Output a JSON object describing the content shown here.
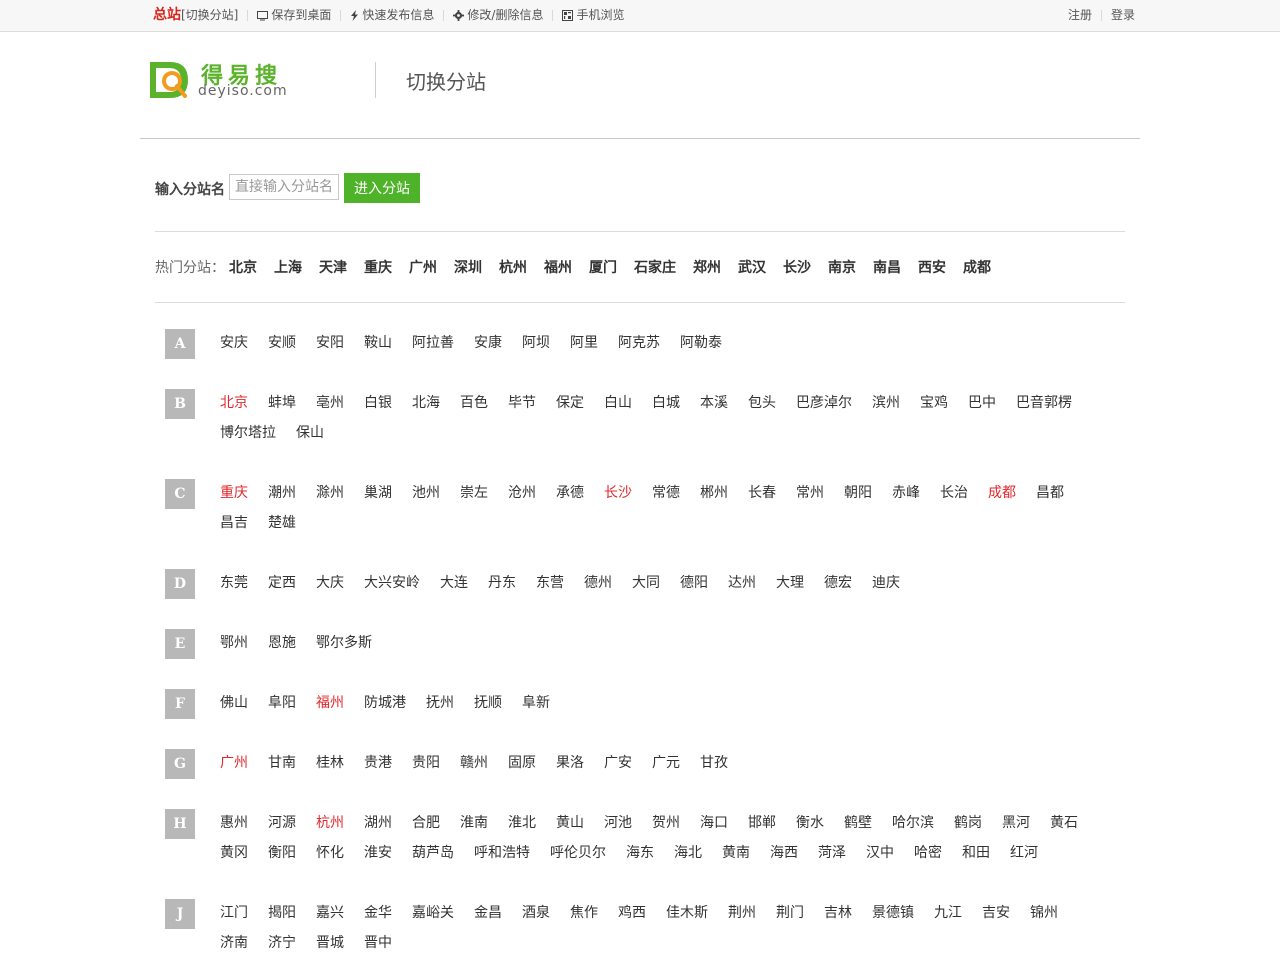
{
  "topbar": {
    "main_site": "总站",
    "switch_link": "[切换分站]",
    "save_desktop": "保存到桌面",
    "quick_post": "快速发布信息",
    "edit_delete": "修改/删除信息",
    "mobile": "手机浏览",
    "register": "注册",
    "login": "登录"
  },
  "header": {
    "logo_cn": "得易搜",
    "logo_en": "deyiso.com",
    "title": "切换分站"
  },
  "search": {
    "label": "输入分站名",
    "placeholder": "直接输入分站名",
    "button": "进入分站"
  },
  "hot": {
    "label": "热门分站：",
    "cities": [
      "北京",
      "上海",
      "天津",
      "重庆",
      "广州",
      "深圳",
      "杭州",
      "福州",
      "厦门",
      "石家庄",
      "郑州",
      "武汉",
      "长沙",
      "南京",
      "南昌",
      "西安",
      "成都"
    ]
  },
  "colors": {
    "accent_green": "#4fb32a",
    "hot_red": "#e0282e",
    "badge_gray": "#b8b8b8"
  },
  "groups": [
    {
      "letter": "A",
      "cities": [
        {
          "name": "安庆"
        },
        {
          "name": "安顺"
        },
        {
          "name": "安阳"
        },
        {
          "name": "鞍山"
        },
        {
          "name": "阿拉善"
        },
        {
          "name": "安康"
        },
        {
          "name": "阿坝"
        },
        {
          "name": "阿里"
        },
        {
          "name": "阿克苏"
        },
        {
          "name": "阿勒泰"
        }
      ]
    },
    {
      "letter": "B",
      "cities": [
        {
          "name": "北京",
          "hot": true
        },
        {
          "name": "蚌埠"
        },
        {
          "name": "亳州"
        },
        {
          "name": "白银"
        },
        {
          "name": "北海"
        },
        {
          "name": "百色"
        },
        {
          "name": "毕节"
        },
        {
          "name": "保定"
        },
        {
          "name": "白山"
        },
        {
          "name": "白城"
        },
        {
          "name": "本溪"
        },
        {
          "name": "包头"
        },
        {
          "name": "巴彦淖尔"
        },
        {
          "name": "滨州"
        },
        {
          "name": "宝鸡"
        },
        {
          "name": "巴中"
        },
        {
          "name": "巴音郭楞"
        },
        {
          "name": "博尔塔拉"
        },
        {
          "name": "保山"
        }
      ]
    },
    {
      "letter": "C",
      "cities": [
        {
          "name": "重庆",
          "hot": true
        },
        {
          "name": "潮州"
        },
        {
          "name": "滁州"
        },
        {
          "name": "巢湖"
        },
        {
          "name": "池州"
        },
        {
          "name": "崇左"
        },
        {
          "name": "沧州"
        },
        {
          "name": "承德"
        },
        {
          "name": "长沙",
          "hot": true
        },
        {
          "name": "常德"
        },
        {
          "name": "郴州"
        },
        {
          "name": "长春"
        },
        {
          "name": "常州"
        },
        {
          "name": "朝阳"
        },
        {
          "name": "赤峰"
        },
        {
          "name": "长治"
        },
        {
          "name": "成都",
          "hot": true
        },
        {
          "name": "昌都"
        },
        {
          "name": "昌吉"
        },
        {
          "name": "楚雄"
        }
      ]
    },
    {
      "letter": "D",
      "cities": [
        {
          "name": "东莞"
        },
        {
          "name": "定西"
        },
        {
          "name": "大庆"
        },
        {
          "name": "大兴安岭"
        },
        {
          "name": "大连"
        },
        {
          "name": "丹东"
        },
        {
          "name": "东营"
        },
        {
          "name": "德州"
        },
        {
          "name": "大同"
        },
        {
          "name": "德阳"
        },
        {
          "name": "达州"
        },
        {
          "name": "大理"
        },
        {
          "name": "德宏"
        },
        {
          "name": "迪庆"
        }
      ]
    },
    {
      "letter": "E",
      "cities": [
        {
          "name": "鄂州"
        },
        {
          "name": "恩施"
        },
        {
          "name": "鄂尔多斯"
        }
      ]
    },
    {
      "letter": "F",
      "cities": [
        {
          "name": "佛山"
        },
        {
          "name": "阜阳"
        },
        {
          "name": "福州",
          "hot": true
        },
        {
          "name": "防城港"
        },
        {
          "name": "抚州"
        },
        {
          "name": "抚顺"
        },
        {
          "name": "阜新"
        }
      ]
    },
    {
      "letter": "G",
      "cities": [
        {
          "name": "广州",
          "hot": true
        },
        {
          "name": "甘南"
        },
        {
          "name": "桂林"
        },
        {
          "name": "贵港"
        },
        {
          "name": "贵阳"
        },
        {
          "name": "赣州"
        },
        {
          "name": "固原"
        },
        {
          "name": "果洛"
        },
        {
          "name": "广安"
        },
        {
          "name": "广元"
        },
        {
          "name": "甘孜"
        }
      ]
    },
    {
      "letter": "H",
      "cities": [
        {
          "name": "惠州"
        },
        {
          "name": "河源"
        },
        {
          "name": "杭州",
          "hot": true
        },
        {
          "name": "湖州"
        },
        {
          "name": "合肥"
        },
        {
          "name": "淮南"
        },
        {
          "name": "淮北"
        },
        {
          "name": "黄山"
        },
        {
          "name": "河池"
        },
        {
          "name": "贺州"
        },
        {
          "name": "海口"
        },
        {
          "name": "邯郸"
        },
        {
          "name": "衡水"
        },
        {
          "name": "鹤壁"
        },
        {
          "name": "哈尔滨"
        },
        {
          "name": "鹤岗"
        },
        {
          "name": "黑河"
        },
        {
          "name": "黄石"
        },
        {
          "name": "黄冈"
        },
        {
          "name": "衡阳"
        },
        {
          "name": "怀化"
        },
        {
          "name": "淮安"
        },
        {
          "name": "葫芦岛"
        },
        {
          "name": "呼和浩特"
        },
        {
          "name": "呼伦贝尔"
        },
        {
          "name": "海东"
        },
        {
          "name": "海北"
        },
        {
          "name": "黄南"
        },
        {
          "name": "海西"
        },
        {
          "name": "菏泽"
        },
        {
          "name": "汉中"
        },
        {
          "name": "哈密"
        },
        {
          "name": "和田"
        },
        {
          "name": "红河"
        }
      ]
    },
    {
      "letter": "J",
      "cities": [
        {
          "name": "江门"
        },
        {
          "name": "揭阳"
        },
        {
          "name": "嘉兴"
        },
        {
          "name": "金华"
        },
        {
          "name": "嘉峪关"
        },
        {
          "name": "金昌"
        },
        {
          "name": "酒泉"
        },
        {
          "name": "焦作"
        },
        {
          "name": "鸡西"
        },
        {
          "name": "佳木斯"
        },
        {
          "name": "荆州"
        },
        {
          "name": "荆门"
        },
        {
          "name": "吉林"
        },
        {
          "name": "景德镇"
        },
        {
          "name": "九江"
        },
        {
          "name": "吉安"
        },
        {
          "name": "锦州"
        },
        {
          "name": "济南"
        },
        {
          "name": "济宁"
        },
        {
          "name": "晋城"
        },
        {
          "name": "晋中"
        }
      ]
    }
  ]
}
